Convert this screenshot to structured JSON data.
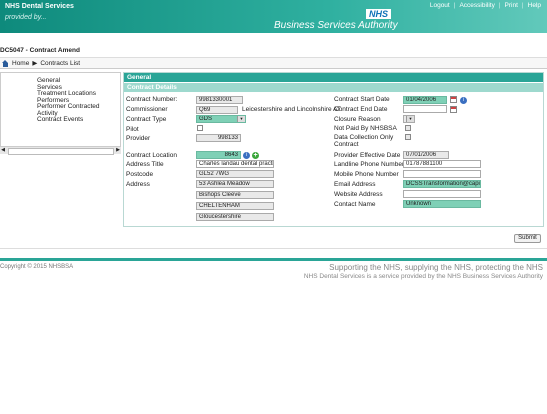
{
  "header": {
    "brand": "NHS Dental Services",
    "tagline": "provided by...",
    "logo": "NHS",
    "org": "Business Services Authority",
    "links": [
      "Logout",
      "Accessibility",
      "Print",
      "Help"
    ]
  },
  "page": {
    "title": "DC5047 - Contract Amend"
  },
  "breadcrumb": {
    "home": "Home",
    "current": "Contracts List"
  },
  "leftnav": {
    "items": [
      "General",
      "Services",
      "Treatment Locations",
      "Performers",
      "Performer Contracted Activity",
      "Contract Events"
    ]
  },
  "panel": {
    "header1": "General",
    "header2": "Contract Details"
  },
  "left_fields": {
    "contract_number_label": "Contract Number:",
    "contract_number": "9981330001",
    "commissioner_label": "Commissioner",
    "commissioner_code": "Q69",
    "commissioner_name": "Leicestershire and Lincolnshire AT",
    "contract_type_label": "Contract Type",
    "contract_type": "GDS",
    "pilot_label": "Pilot",
    "provider_label": "Provider",
    "provider": "998133",
    "contract_location_label": "Contract Location",
    "contract_location": "8643",
    "address_title_label": "Address Title",
    "address_title": "Charles landau dental practice",
    "postcode_label": "Postcode",
    "postcode": "GL52 7WG",
    "address_label": "Address",
    "address_lines": [
      "53 Ashlea Meadow",
      "Bishops Cleeve",
      "CHELTENHAM",
      "Gloucestershire",
      ""
    ]
  },
  "right_fields": {
    "start_date_label": "Contract Start Date",
    "start_date": "01/04/2006",
    "end_date_label": "Contract End Date",
    "end_date": "",
    "closure_reason_label": "Closure Reason",
    "closure_reason": "",
    "not_paid_label": "Not Paid By NHSBSA",
    "data_collection_label": "Data Collection Only Contract",
    "provider_effective_label": "Provider Effective Date",
    "provider_effective": "07/01/2006",
    "landline_label": "Landline Phone Number",
    "landline": "01787881100",
    "mobile_label": "Mobile Phone Number",
    "mobile": "",
    "email_label": "Email Address",
    "email": "DCSSTransformation@capita",
    "website_label": "Website Address",
    "website": "",
    "contact_label": "Contact Name",
    "contact": "Unknown"
  },
  "actions": {
    "submit": "Submit"
  },
  "footer": {
    "copyright": "Copyright © 2015 NHSBSA",
    "support": "Supporting the NHS, supplying the NHS, protecting the NHS",
    "provided": "NHS Dental Services is a service provided by the NHS Business Services Authority"
  }
}
